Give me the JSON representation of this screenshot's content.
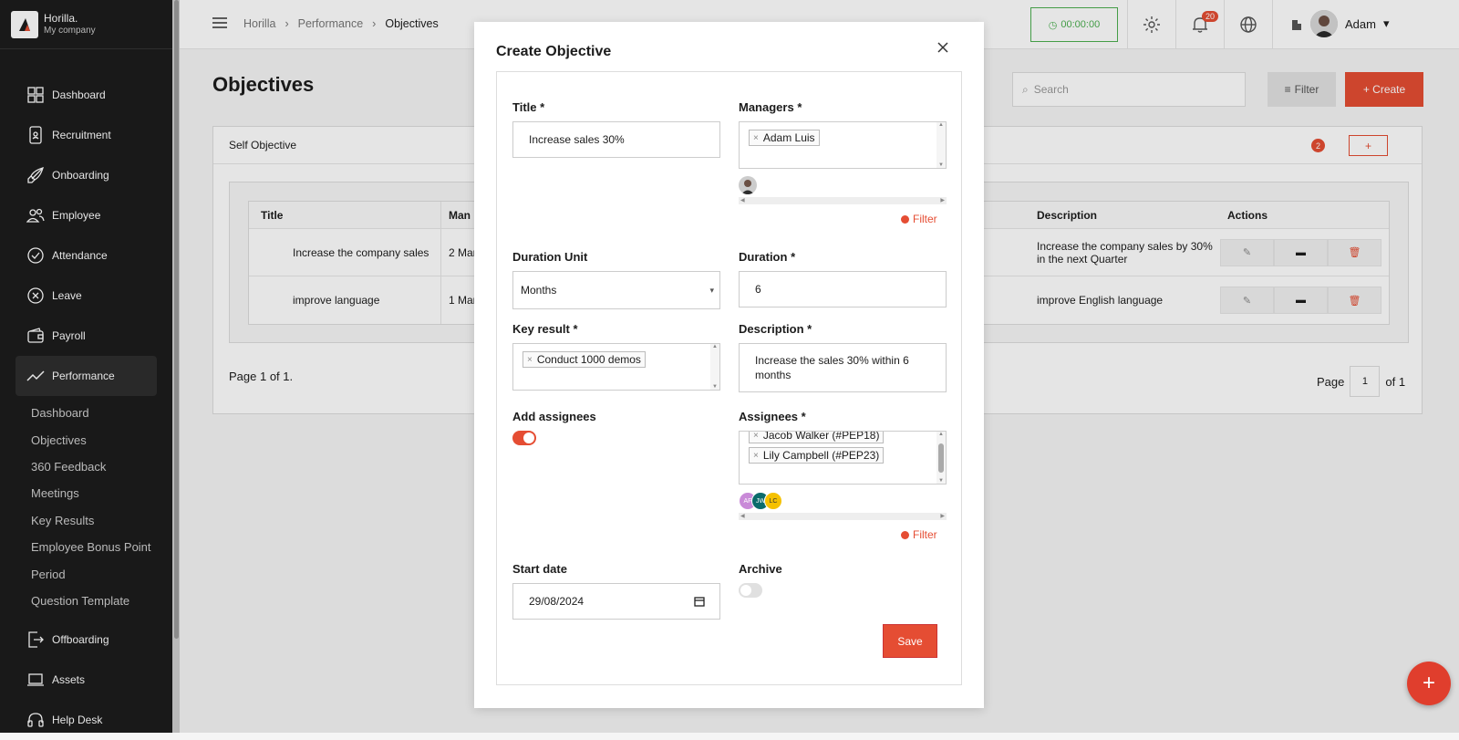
{
  "brand": {
    "name": "Horilla.",
    "sub": "My company"
  },
  "sidebar": {
    "items": [
      {
        "label": "Dashboard",
        "icon": "dashboard-icon"
      },
      {
        "label": "Recruitment",
        "icon": "recruitment-icon"
      },
      {
        "label": "Onboarding",
        "icon": "rocket-icon"
      },
      {
        "label": "Employee",
        "icon": "people-icon"
      },
      {
        "label": "Attendance",
        "icon": "check-circle-icon"
      },
      {
        "label": "Leave",
        "icon": "x-circle-icon"
      },
      {
        "label": "Payroll",
        "icon": "wallet-icon"
      },
      {
        "label": "Performance",
        "icon": "trend-icon"
      }
    ],
    "sub_items": [
      "Dashboard",
      "Objectives",
      "360 Feedback",
      "Meetings",
      "Key Results",
      "Employee Bonus Point",
      "Period",
      "Question Template"
    ],
    "bottom_items": [
      {
        "label": "Offboarding",
        "icon": "exit-icon"
      },
      {
        "label": "Assets",
        "icon": "laptop-icon"
      },
      {
        "label": "Help Desk",
        "icon": "headset-icon"
      }
    ]
  },
  "topbar": {
    "crumbs": [
      "Horilla",
      "Performance",
      "Objectives"
    ],
    "timer": "00:00:00",
    "notif_count": "20",
    "user": "Adam"
  },
  "page": {
    "title": "Objectives",
    "search_placeholder": "Search",
    "filter": "Filter",
    "create": "+ Create",
    "panel_title": "Self Objective",
    "panel_count": "2",
    "add": "+",
    "table": {
      "headers": [
        "Title",
        "Man",
        "Description",
        "Actions"
      ],
      "rows": [
        {
          "title": "Increase the company sales",
          "manager": "2 Man",
          "desc": "Increase the company sales by 30% in the next Quarter"
        },
        {
          "title": "improve language",
          "manager": "1 Man",
          "desc": "improve English language"
        }
      ]
    },
    "pager_left": "Page 1 of 1.",
    "pager_page": "Page",
    "pager_num": "1",
    "pager_of": "of 1"
  },
  "modal": {
    "title": "Create Objective",
    "title_label": "Title",
    "title_value": "Increase sales 30%",
    "managers_label": "Managers",
    "managers": [
      "Adam Luis"
    ],
    "filter": "Filter",
    "duration_unit_label": "Duration Unit",
    "duration_unit": "Months",
    "duration_label": "Duration",
    "duration": "6",
    "key_result_label": "Key result",
    "key_results": [
      "Conduct 1000 demos"
    ],
    "description_label": "Description",
    "description": "Increase the sales 30% within 6 months",
    "add_assignees_label": "Add assignees",
    "assignees_label": "Assignees",
    "assignees": [
      "Jacob Walker (#PEP18)",
      "Lily Campbell (#PEP23)"
    ],
    "assignee_avatars": [
      "AF",
      "JW",
      "LC"
    ],
    "start_date_label": "Start date",
    "start_date": "29/08/2024",
    "archive_label": "Archive",
    "save": "Save",
    "required": "*"
  },
  "colors": {
    "accent": "#e54d33",
    "sidebar": "#1c1c1c",
    "timer": "#4caf50"
  }
}
